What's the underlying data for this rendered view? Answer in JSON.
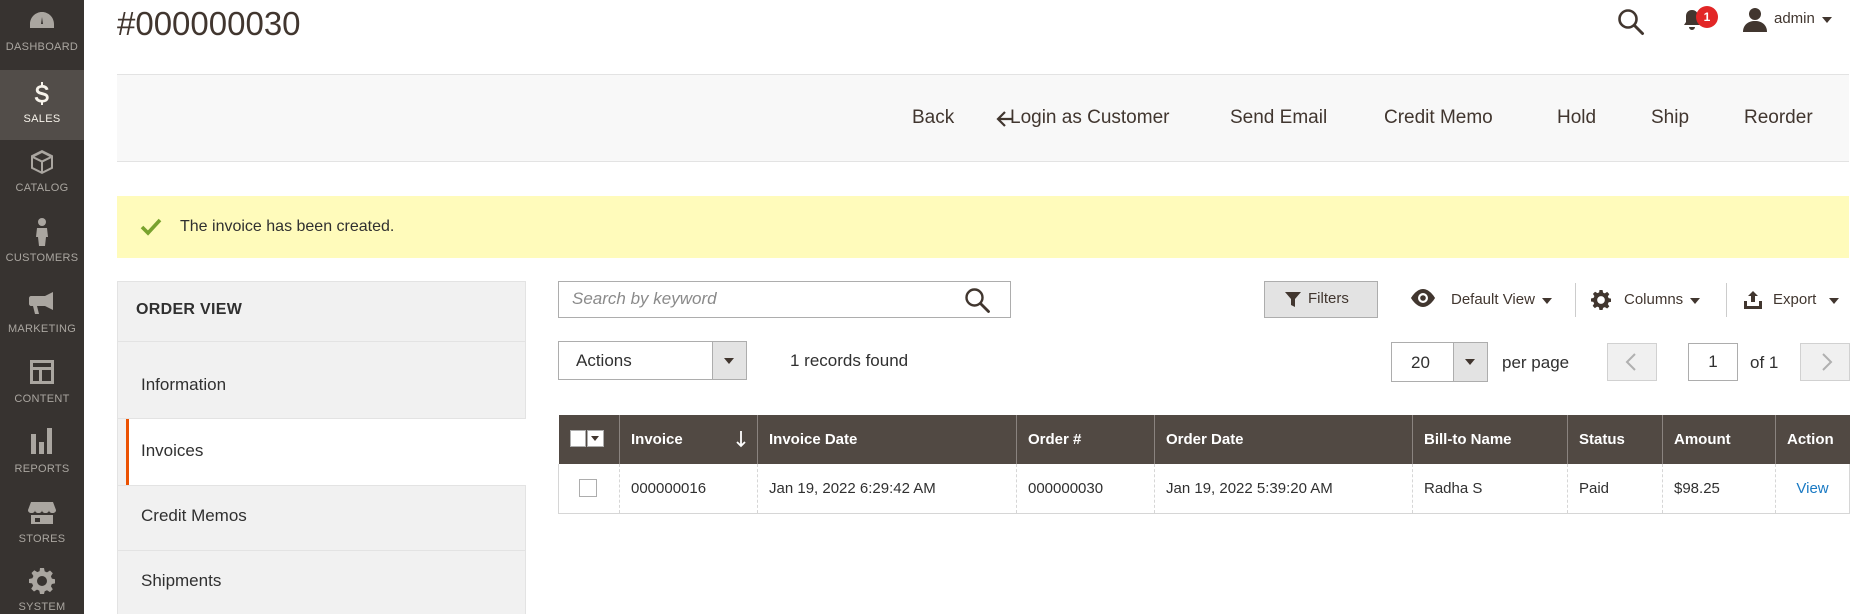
{
  "nav": {
    "items": [
      {
        "label": "DASHBOARD",
        "icon": "dashboard-icon"
      },
      {
        "label": "SALES",
        "icon": "dollar-icon",
        "active": true
      },
      {
        "label": "CATALOG",
        "icon": "cube-icon"
      },
      {
        "label": "CUSTOMERS",
        "icon": "person-icon"
      },
      {
        "label": "MARKETING",
        "icon": "megaphone-icon"
      },
      {
        "label": "CONTENT",
        "icon": "layout-icon"
      },
      {
        "label": "REPORTS",
        "icon": "bar-chart-icon"
      },
      {
        "label": "STORES",
        "icon": "storefront-icon"
      },
      {
        "label": "SYSTEM",
        "icon": "gear-icon"
      }
    ]
  },
  "header": {
    "title": "#000000030",
    "notifications_count": "1",
    "user": "admin"
  },
  "toolbar": {
    "back": "Back",
    "login_as_customer": "Login as Customer",
    "send_email": "Send Email",
    "credit_memo": "Credit Memo",
    "hold": "Hold",
    "ship": "Ship",
    "reorder": "Reorder"
  },
  "message": {
    "text": "The invoice has been created.",
    "type": "success"
  },
  "order_view": {
    "title": "ORDER VIEW",
    "tabs": [
      {
        "label": "Information"
      },
      {
        "label": "Invoices",
        "active": true
      },
      {
        "label": "Credit Memos"
      },
      {
        "label": "Shipments"
      }
    ]
  },
  "grid": {
    "search_placeholder": "Search by keyword",
    "filters": "Filters",
    "view": "Default View",
    "columns": "Columns",
    "export": "Export",
    "actions": "Actions",
    "records_found": "1 records found",
    "per_page_value": "20",
    "per_page_label": "per page",
    "page": "1",
    "of_pages": "of 1",
    "headers": [
      "Invoice",
      "Invoice Date",
      "Order #",
      "Order Date",
      "Bill-to Name",
      "Status",
      "Amount",
      "Action"
    ],
    "rows": [
      {
        "invoice": "000000016",
        "invoice_date": "Jan 19, 2022 6:29:42 AM",
        "order": "000000030",
        "order_date": "Jan 19, 2022 5:39:20 AM",
        "bill_to": "Radha S",
        "status": "Paid",
        "amount": "$98.25",
        "action": "View"
      }
    ]
  },
  "colors": {
    "nav_bg": "#373330",
    "nav_active": "#524d49",
    "grid_header": "#514943",
    "accent": "#eb5202",
    "message_bg": "#fffbbb",
    "link": "#1979c3"
  }
}
